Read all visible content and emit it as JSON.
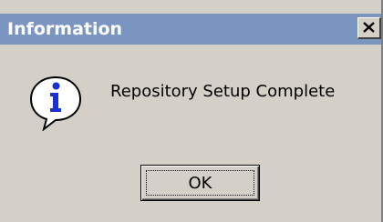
{
  "window": {
    "title": "Information",
    "close_label": "X"
  },
  "content": {
    "icon": "information-icon",
    "message": "Repository Setup Complete"
  },
  "buttons": {
    "ok_label": "OK"
  },
  "colors": {
    "titlebar": "#7a96c0",
    "dialog_background": "#d4d0c8",
    "icon_blue": "#1c2fd0"
  }
}
